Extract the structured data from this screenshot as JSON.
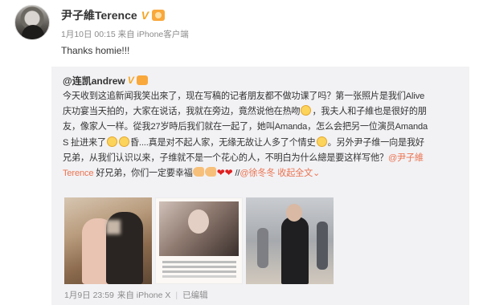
{
  "post": {
    "author": "尹子維Terence",
    "verified_badge": "V",
    "time": "1月10日 00:15",
    "source": "来自 iPhone客户端",
    "text": "Thanks homie!!!"
  },
  "repost": {
    "author_at": "@连凯andrew",
    "verified_badge": "V",
    "lines": [
      "今天收到这追新闻我笑出來了，现在写稿的记者朋友都不做功课了吗？第一张照片是我们Alive",
      "庆功宴当天拍的，大家在说话，我就在旁边，竟然说他在热吻",
      "，我夫人和子維也是很好的朋",
      "友，像家人一样。從我27岁時后我们就在一起了，她叫Amanda，怎么会把另一位演员Amanda",
      "S 扯进来了",
      "昏....真是对不起人家，无缘无故让人多了个情史",
      "。另外尹子维一向是我好",
      "兄弟，从我们认识以来，子维就不是一个花心的人，不明白为什么總是要这样写他？",
      "@尹子維",
      "Terence",
      " 好兄弟，你们一定要幸福",
      "//",
      "@徐冬冬",
      " 收起全文",
      "⌄"
    ],
    "time": "1月9日 23:59",
    "source": "来自 iPhone X",
    "edited": "已编辑"
  },
  "icons": {
    "avatar": "avatar",
    "emoji": "laughing-emoji-icon",
    "heart": "heart-icon",
    "muscle": "flexed-biceps-icon",
    "medal": "member-medal-icon"
  },
  "colors": {
    "link": "#eb7350",
    "verified": "#f5a623",
    "meta": "#8b8b8b",
    "repost_bg": "#f2f2f5"
  }
}
